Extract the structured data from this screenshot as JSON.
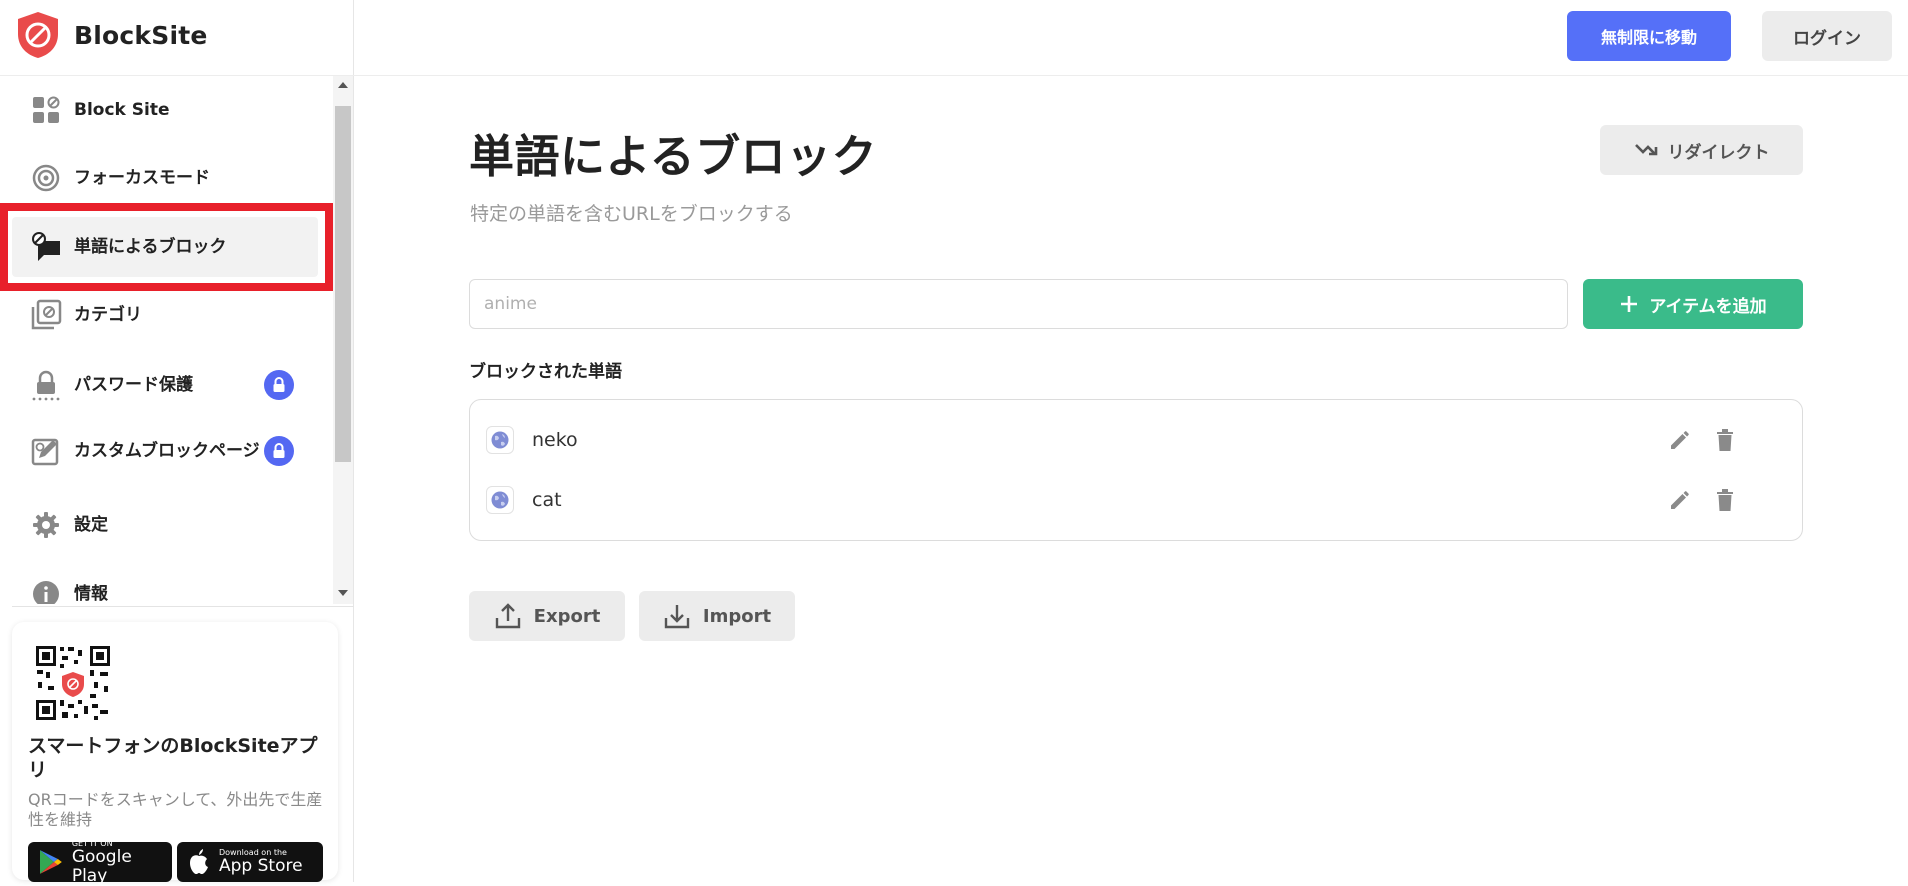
{
  "brand": {
    "name": "BlockSite"
  },
  "header": {
    "upgrade_label": "無制限に移動",
    "login_label": "ログイン"
  },
  "sidebar": {
    "items": [
      {
        "label": "Block Site",
        "icon": "block-site-icon"
      },
      {
        "label": "フォーカスモード",
        "icon": "target-icon"
      },
      {
        "label": "単語によるブロック",
        "icon": "word-block-icon",
        "active": true
      },
      {
        "label": "カテゴリ",
        "icon": "category-icon"
      },
      {
        "label": "パスワード保護",
        "icon": "password-lock-icon",
        "locked": true
      },
      {
        "label": "カスタムブロックページ",
        "icon": "custom-page-icon",
        "locked": true
      },
      {
        "label": "設定",
        "icon": "gear-icon"
      },
      {
        "label": "情報",
        "icon": "info-icon"
      }
    ],
    "promo": {
      "title": "スマートフォンのBlockSiteアプリ",
      "description": "QRコードをスキャンして、外出先で生産性を維持",
      "google_play_small": "GET IT ON",
      "google_play_big": "Google Play",
      "app_store_small": "Download on the",
      "app_store_big": "App Store"
    }
  },
  "main": {
    "title": "単語によるブロック",
    "subtitle": "特定の単語を含むURLをブロックする",
    "redirect_label": "リダイレクト",
    "input_placeholder": "anime",
    "add_label": "アイテムを追加",
    "list_label": "ブロックされた単語",
    "blocked_words": [
      "neko",
      "cat"
    ],
    "export_label": "Export",
    "import_label": "Import"
  },
  "colors": {
    "accent_blue": "#5570f8",
    "accent_green": "#3abb8a",
    "highlight_red": "#e8202a",
    "brand_red": "#e94b4b"
  }
}
